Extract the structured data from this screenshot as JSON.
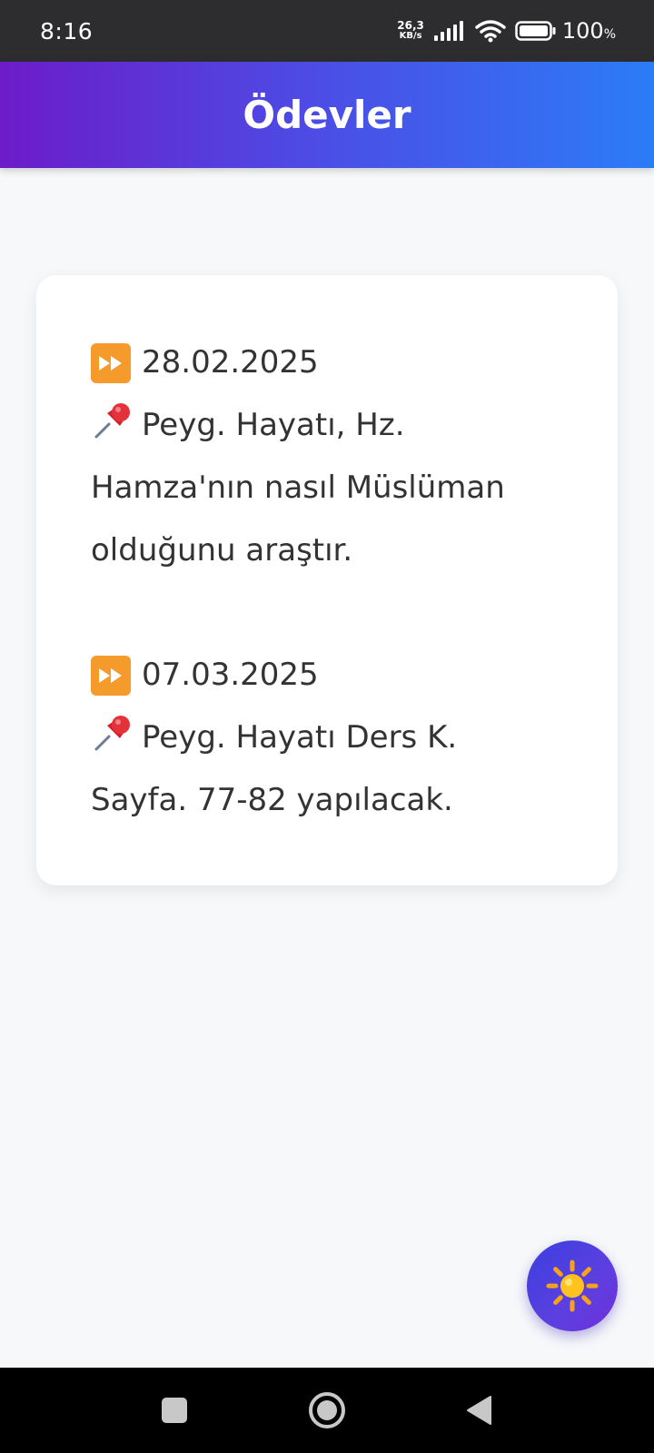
{
  "status_bar": {
    "time": "8:16",
    "net_speed_value": "26,3",
    "net_speed_unit": "KB/s",
    "battery_percent": "100",
    "battery_percent_sign": "%"
  },
  "header": {
    "title": "Ödevler"
  },
  "homework": [
    {
      "date": "28.02.2025",
      "task": "Peyg. Hayatı, Hz. Hamza'nın nasıl Müslüman olduğunu araştır."
    },
    {
      "date": "07.03.2025",
      "task": "Peyg. Hayatı Ders K. Sayfa. 77-82 yapılacak."
    }
  ],
  "fab": {
    "icon": "sun-icon"
  },
  "colors": {
    "header_gradient_start": "#6c1cc9",
    "header_gradient_end": "#2b7cf7",
    "date_marker": "#f49b2c",
    "background": "#f6f8fa"
  }
}
